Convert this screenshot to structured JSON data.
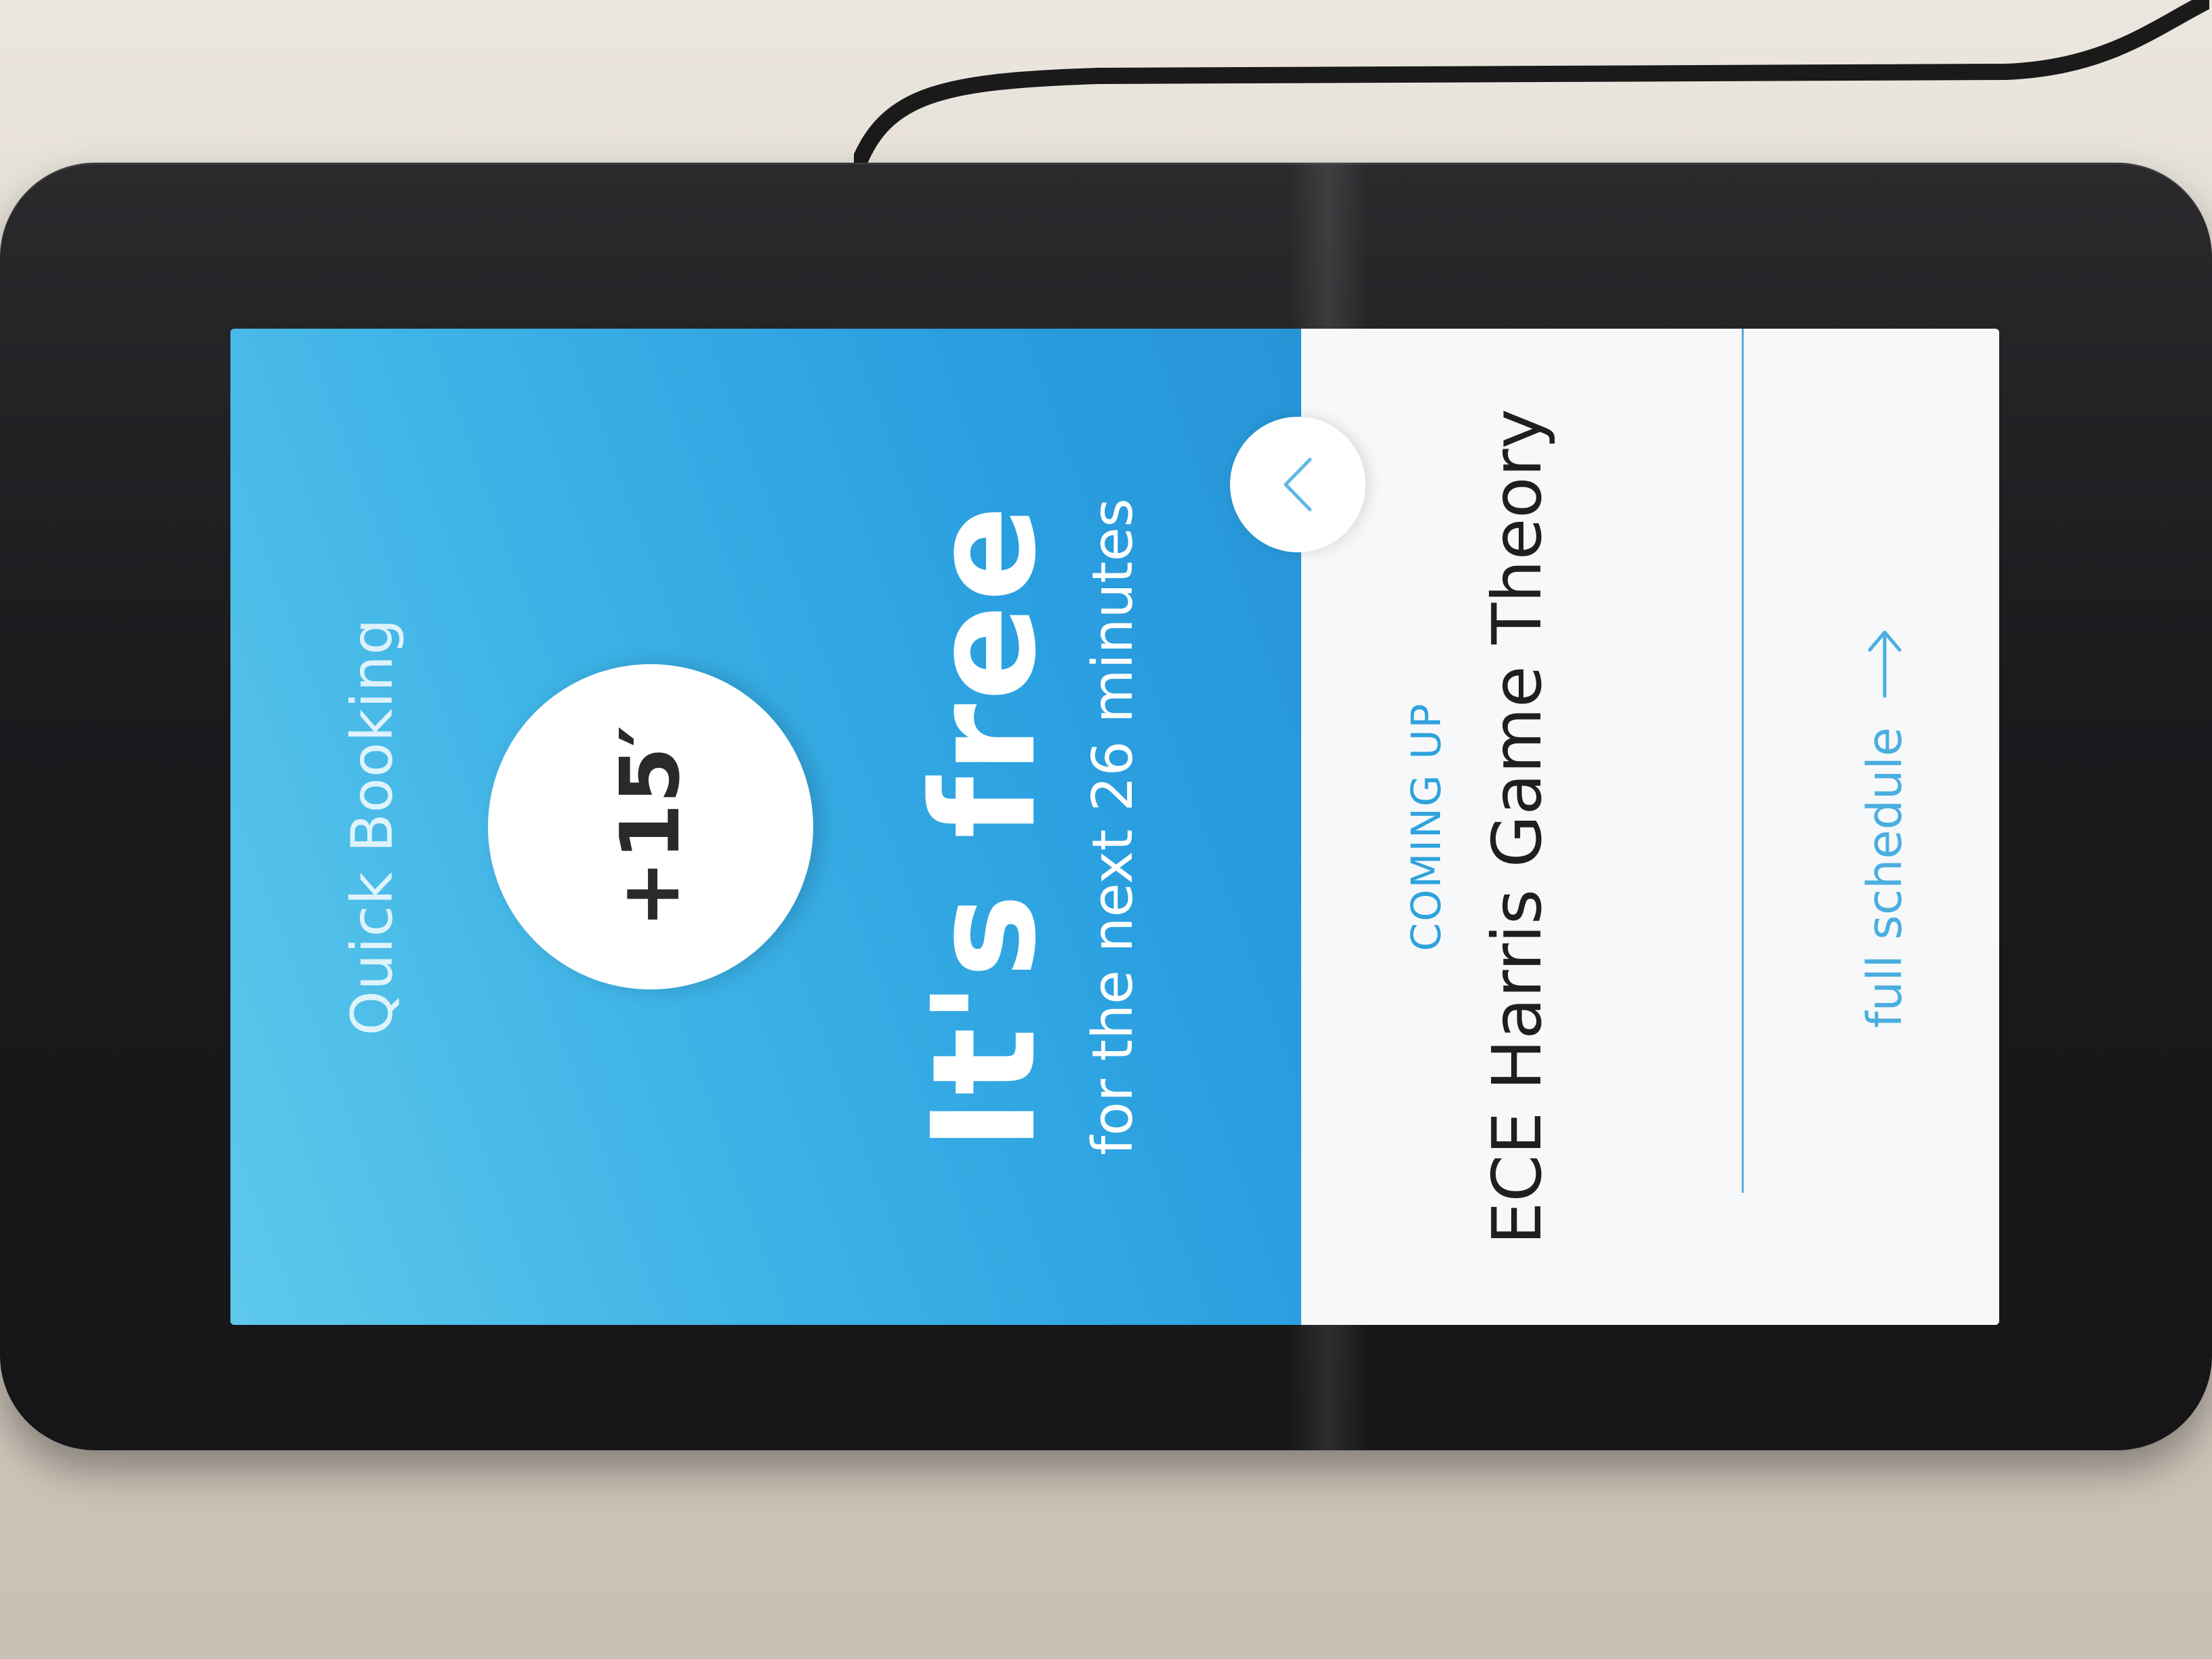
{
  "quick_booking": {
    "label": "Quick Booking",
    "button_label": "+15′"
  },
  "status": {
    "title": "It's free",
    "subtitle": "for the next 26 minutes"
  },
  "upcoming": {
    "section_label": "COMING UP",
    "meeting_title": "ECE Harris Game Theory"
  },
  "footer": {
    "schedule_link_label": "full schedule"
  },
  "icons": {
    "toggle": "chevron-up-icon",
    "schedule_arrow": "arrow-right-icon"
  },
  "colors": {
    "accent_blue": "#2ea3dc",
    "hero_top": "#5ec8ec",
    "hero_bottom": "#2794d6",
    "panel_bg": "#f7f8fa"
  }
}
